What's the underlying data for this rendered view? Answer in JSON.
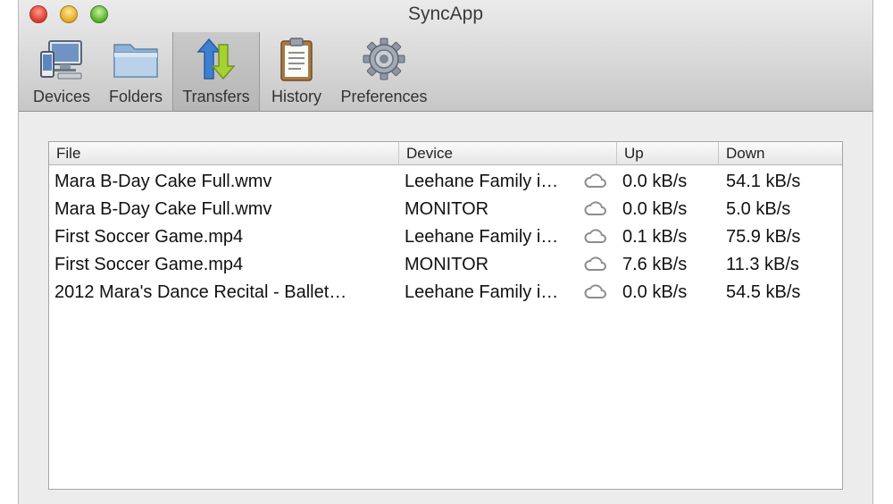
{
  "window": {
    "title": "SyncApp"
  },
  "toolbar": {
    "items": [
      {
        "label": "Devices",
        "icon": "devices-icon"
      },
      {
        "label": "Folders",
        "icon": "folder-icon"
      },
      {
        "label": "Transfers",
        "icon": "transfers-icon",
        "selected": true
      },
      {
        "label": "History",
        "icon": "clipboard-icon"
      },
      {
        "label": "Preferences",
        "icon": "gear-icon"
      }
    ]
  },
  "table": {
    "columns": {
      "file": "File",
      "device": "Device",
      "up": "Up",
      "down": "Down"
    },
    "rows": [
      {
        "file": "Mara B-Day Cake Full.wmv",
        "device": "Leehane Family i…",
        "cloud": true,
        "up": "0.0 kB/s",
        "down": "54.1 kB/s"
      },
      {
        "file": "Mara B-Day Cake Full.wmv",
        "device": "MONITOR",
        "cloud": true,
        "up": "0.0 kB/s",
        "down": "5.0 kB/s"
      },
      {
        "file": "First Soccer Game.mp4",
        "device": "Leehane Family i…",
        "cloud": true,
        "up": "0.1 kB/s",
        "down": "75.9 kB/s"
      },
      {
        "file": "First Soccer Game.mp4",
        "device": "MONITOR",
        "cloud": true,
        "up": "7.6 kB/s",
        "down": "11.3 kB/s"
      },
      {
        "file": "2012 Mara's Dance Recital - Ballet…",
        "device": "Leehane Family i…",
        "cloud": true,
        "up": "0.0 kB/s",
        "down": "54.5 kB/s"
      }
    ]
  }
}
